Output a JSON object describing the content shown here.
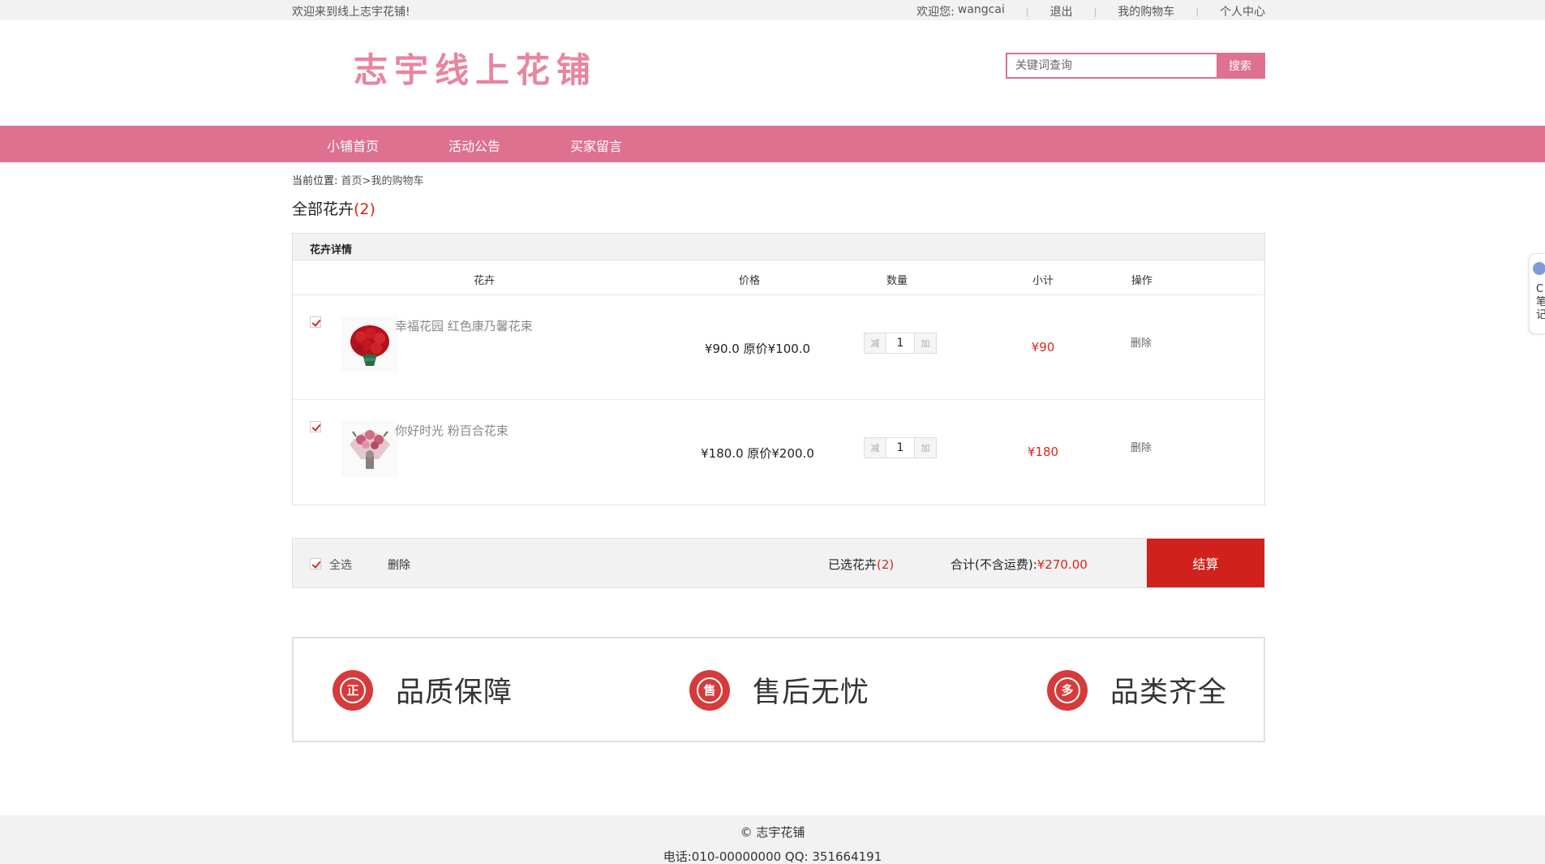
{
  "topbar": {
    "welcome": "欢迎来到线上志宇花铺!",
    "user_prefix": "欢迎您:",
    "username": "wangcai",
    "logout": "退出",
    "cart": "我的购物车",
    "profile": "个人中心"
  },
  "header": {
    "logo": "志宇线上花铺",
    "search_placeholder": "关键词查询",
    "search_button": "搜索"
  },
  "nav": {
    "items": [
      "小铺首页",
      "活动公告",
      "买家留言"
    ]
  },
  "breadcrumb": {
    "prefix": "当前位置:",
    "home": "首页",
    "current": ">我的购物车"
  },
  "section": {
    "title": "全部花卉",
    "count": "(2)"
  },
  "cart": {
    "panel_title": "花卉详情",
    "columns": [
      "花卉",
      "价格",
      "数量",
      "小计",
      "操作"
    ],
    "items": [
      {
        "name": "幸福花园 红色康乃馨花束",
        "price": "¥90.0 原价¥100.0",
        "qty_minus": "减",
        "qty": "1",
        "qty_plus": "加",
        "subtotal": "¥90",
        "action": "删除"
      },
      {
        "name": "你好时光 粉百合花束",
        "price": "¥180.0 原价¥200.0",
        "qty_minus": "减",
        "qty": "1",
        "qty_plus": "加",
        "subtotal": "¥180",
        "action": "删除"
      }
    ]
  },
  "summary": {
    "select_all": "全选",
    "delete": "删除",
    "selected_label": "已选花卉",
    "selected_count": "(2)",
    "total_label": "合计(不含运费):",
    "total_value": "¥270.00",
    "checkout": "结算"
  },
  "guarantee": {
    "items": [
      {
        "icon_char": "正",
        "label": "品质保障"
      },
      {
        "icon_char": "售",
        "label": "售后无忧"
      },
      {
        "icon_char": "多",
        "label": "品类齐全"
      }
    ]
  },
  "footer": {
    "copyright": "© 志宇花铺",
    "contact": "电话:010-00000000 QQ: 351664191"
  },
  "side_widget": {
    "text": "C笔记"
  },
  "colors": {
    "brand_pink": "#de7090",
    "price_red": "#d9261c",
    "checkout_red": "#d0211d"
  }
}
